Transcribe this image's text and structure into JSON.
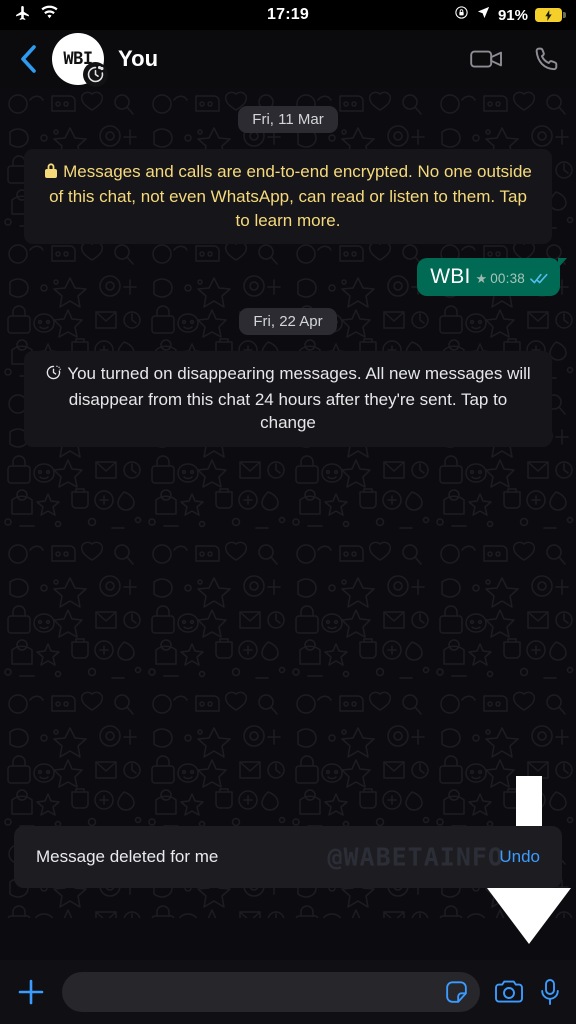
{
  "status_bar": {
    "airplane_icon": "airplane-mode-icon",
    "wifi_icon": "wifi-icon",
    "time": "17:19",
    "rotation_lock_icon": "rotation-lock-icon",
    "location_icon": "location-arrow-icon",
    "battery_percent": "91%",
    "battery_icon": "battery-charging-icon",
    "battery_color": "#f5cf2a"
  },
  "header": {
    "back_icon": "back-chevron-icon",
    "back_color": "#2f9bf0",
    "avatar_text": "WBI",
    "avatar_timer_icon": "disappearing-timer-icon",
    "title": "You",
    "video_call_icon": "video-call-icon",
    "voice_call_icon": "voice-call-icon"
  },
  "chat": {
    "date_chip_1": "Fri, 11 Mar",
    "encryption_notice": {
      "lock_icon": "lock-icon",
      "text": "Messages and calls are end-to-end encrypted. No one outside of this chat, not even WhatsApp, can read or listen to them. Tap to learn more.",
      "color": "#f5d97a"
    },
    "outgoing_message": {
      "text": "WBI",
      "starred_icon": "star-icon",
      "time": "00:38",
      "status_icon": "read-double-check-icon",
      "bubble_color": "#006a55",
      "tick_color": "#53bdeb"
    },
    "date_chip_2": "Fri, 22 Apr",
    "disappearing_notice": {
      "timer_icon": "disappearing-timer-icon",
      "text": "You turned on disappearing messages. All new messages will disappear from this chat 24 hours after they're sent. Tap to change"
    }
  },
  "annotation": {
    "arrow_icon": "down-arrow-annotation",
    "color": "#ffffff"
  },
  "snackbar": {
    "message": "Message deleted for me",
    "undo_label": "Undo",
    "undo_color": "#3b9bff",
    "watermark": "@WABETAINFO"
  },
  "input_bar": {
    "plus_icon": "plus-icon",
    "input_value": "",
    "input_placeholder": "",
    "sticker_icon": "sticker-icon",
    "camera_icon": "camera-icon",
    "mic_icon": "microphone-icon",
    "accent_color": "#3b9bff"
  }
}
